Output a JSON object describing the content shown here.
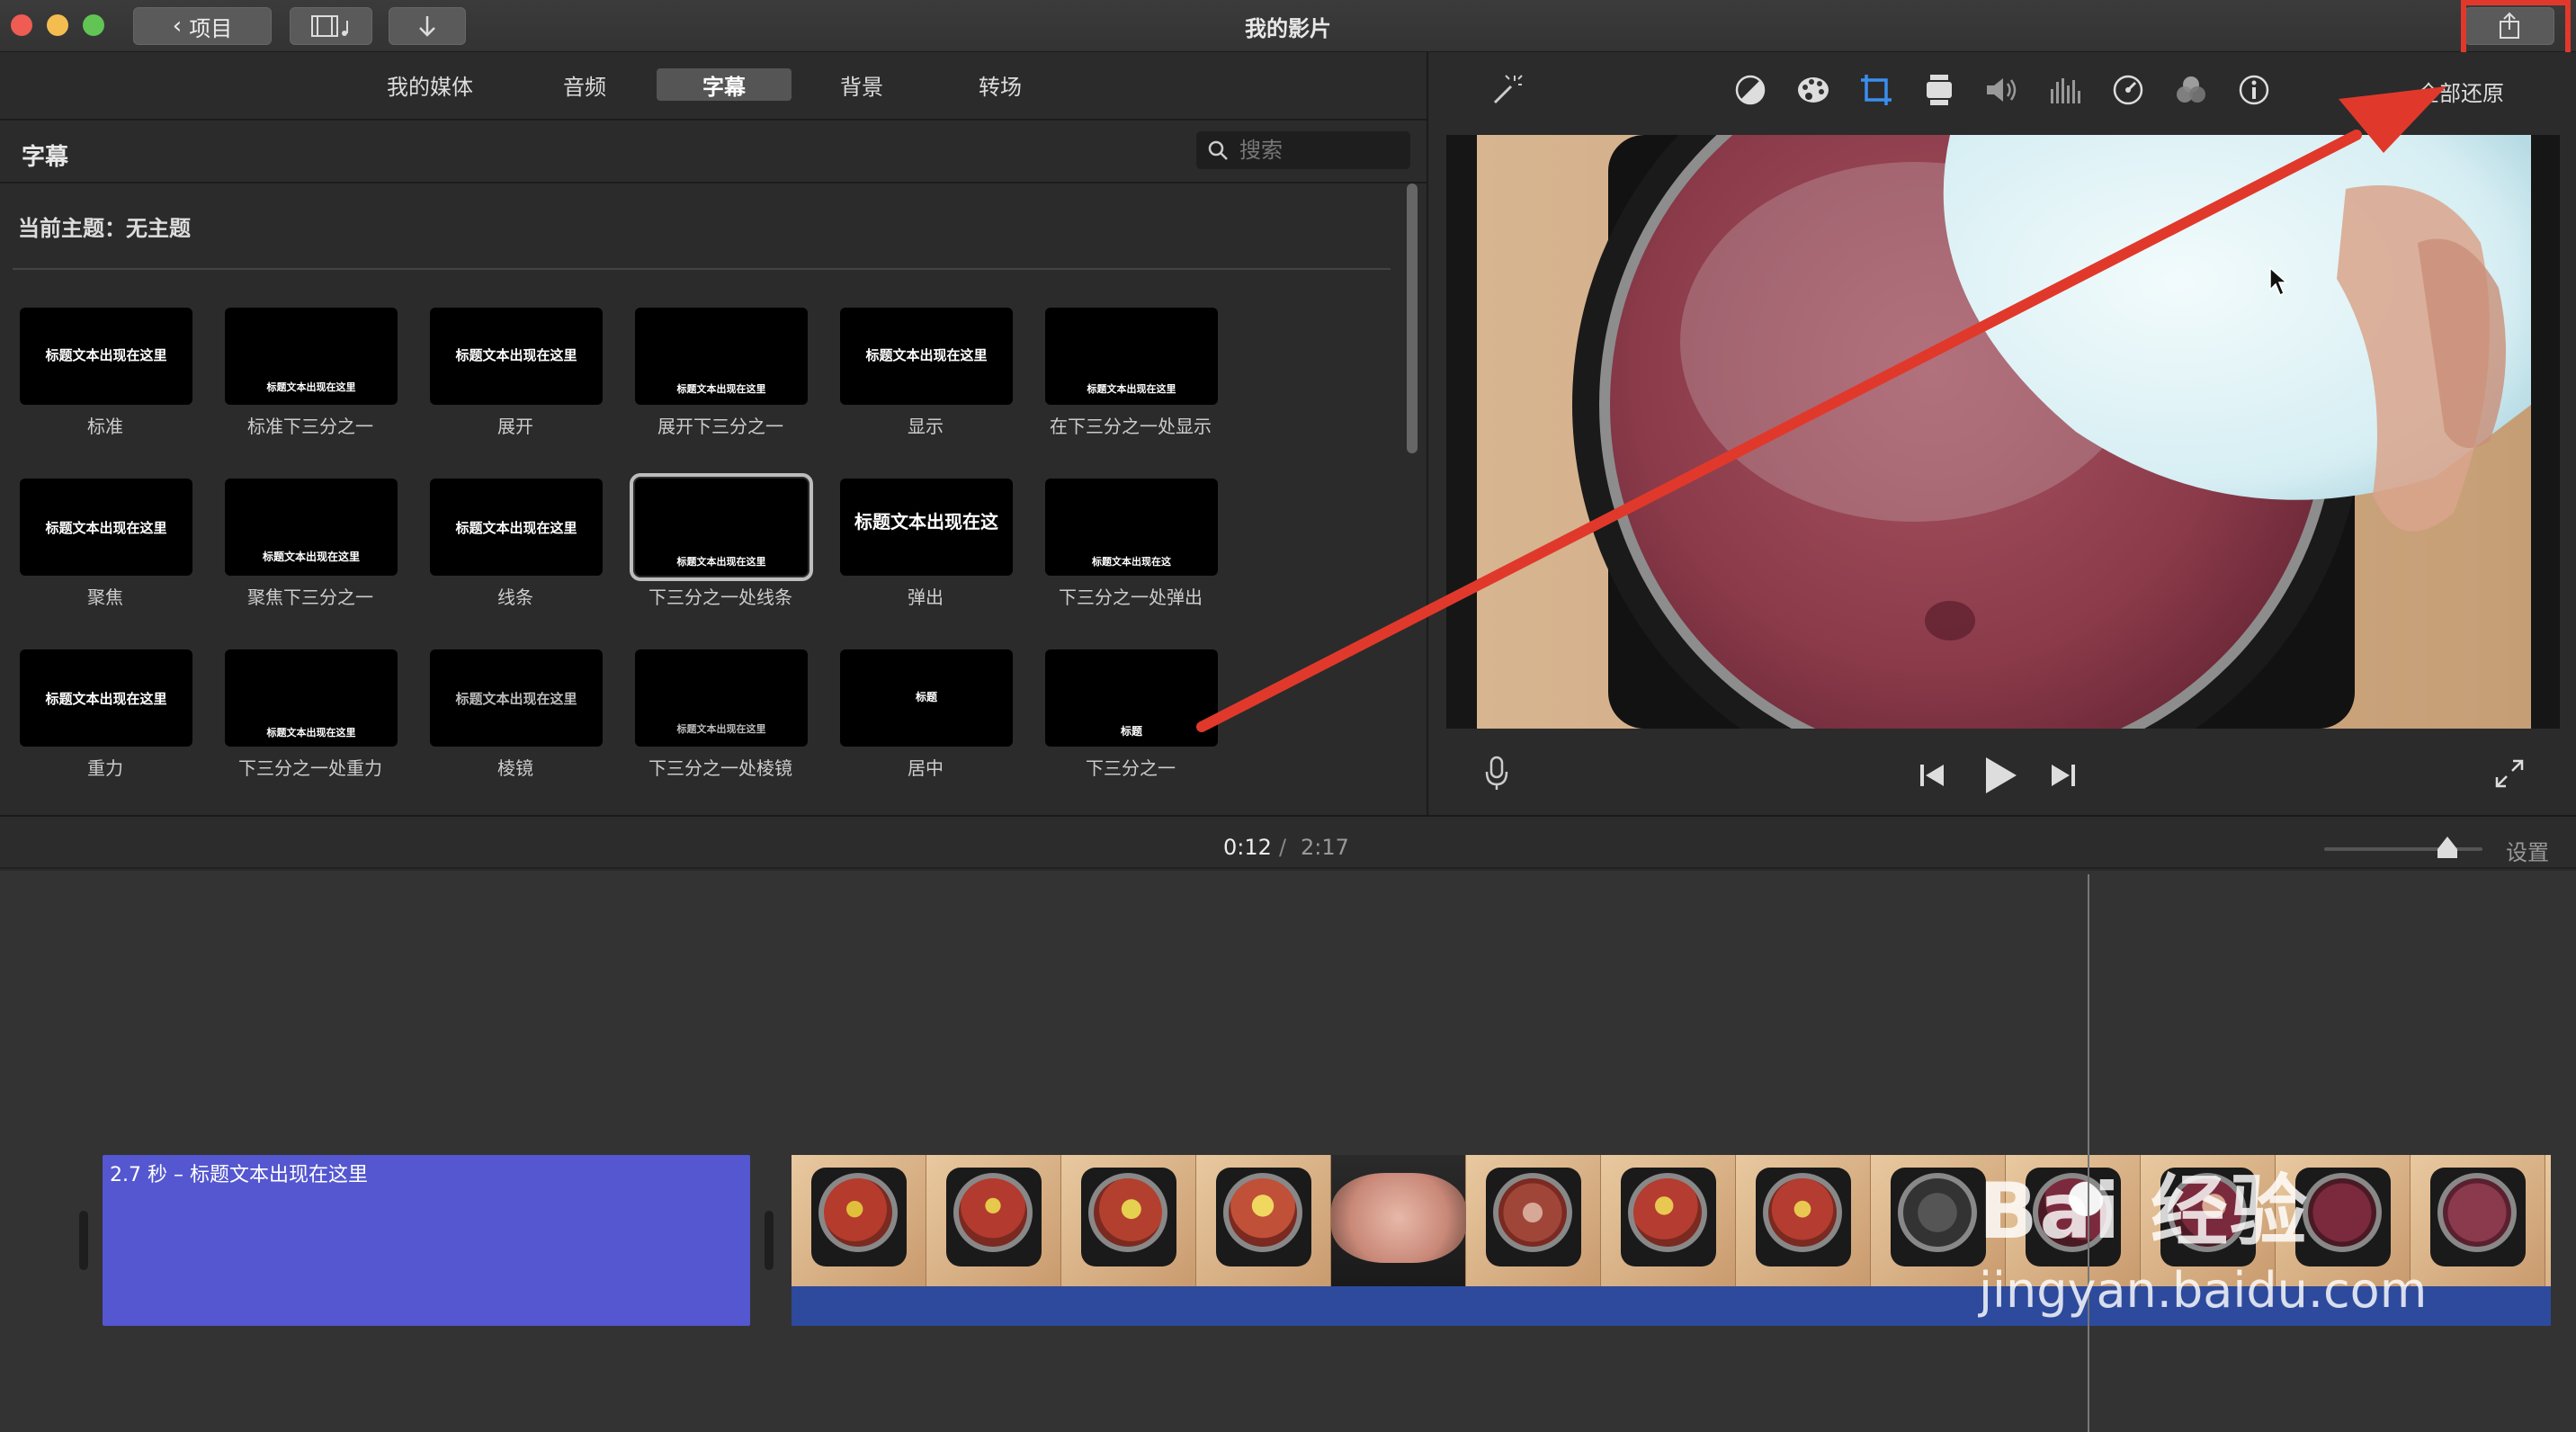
{
  "window": {
    "back_label": "项目",
    "title": "我的影片"
  },
  "browser": {
    "tabs": [
      {
        "label": "我的媒体",
        "active": false
      },
      {
        "label": "音频",
        "active": false
      },
      {
        "label": "字幕",
        "active": true
      },
      {
        "label": "背景",
        "active": false
      },
      {
        "label": "转场",
        "active": false
      }
    ],
    "section_title": "字幕",
    "search_placeholder": "搜索",
    "theme_label": "当前主题：无主题",
    "titles": [
      {
        "label": "标准",
        "preview": "标题文本出现在这里",
        "selected": false
      },
      {
        "label": "标准下三分之一",
        "preview": "标题文本出现在这里",
        "selected": false
      },
      {
        "label": "展开",
        "preview": "标题文本出现在这里",
        "selected": false
      },
      {
        "label": "展开下三分之一",
        "preview": "标题文本出现在这里",
        "selected": false
      },
      {
        "label": "显示",
        "preview": "标题文本出现在这里",
        "selected": false
      },
      {
        "label": "在下三分之一处显示",
        "preview": "标题文本出现在这里",
        "selected": false
      },
      {
        "label": "聚焦",
        "preview": "标题文本出现在这里",
        "selected": false
      },
      {
        "label": "聚焦下三分之一",
        "preview": "标题文本出现在这里",
        "selected": false
      },
      {
        "label": "线条",
        "preview": "标题文本出现在这里",
        "selected": false
      },
      {
        "label": "下三分之一处线条",
        "preview": "标题文本出现在这里",
        "selected": true
      },
      {
        "label": "弹出",
        "preview": "标题文本出现在这",
        "selected": false
      },
      {
        "label": "下三分之一处弹出",
        "preview": "标题文本出现在这",
        "selected": false
      },
      {
        "label": "重力",
        "preview": "标题文本出现在这里",
        "selected": false
      },
      {
        "label": "下三分之一处重力",
        "preview": "标题文本出现在这里",
        "selected": false
      },
      {
        "label": "棱镜",
        "preview": "标题文本出现在这里",
        "selected": false
      },
      {
        "label": "下三分之一处棱镜",
        "preview": "标题文本出现在这里",
        "selected": false
      },
      {
        "label": "居中",
        "preview": "标题",
        "selected": false
      },
      {
        "label": "下三分之一",
        "preview": "标题",
        "selected": false
      }
    ]
  },
  "viewer": {
    "reset_label": "全部还原",
    "tools": [
      "magic-wand-icon",
      "color-balance-icon",
      "color-palette-icon",
      "crop-icon",
      "stabilization-icon",
      "volume-icon",
      "equalizer-icon",
      "speed-icon",
      "filter-icon",
      "info-icon"
    ]
  },
  "timeline": {
    "current_time": "0:12",
    "separator": "/",
    "total_time": "2:17",
    "settings_label": "设置",
    "zoom_level": 0.78,
    "title_clip_label": "2.7 秒 – 标题文本出现在这里"
  },
  "watermark": {
    "main": "Bai 经验",
    "sub": "jingyan.baidu.com"
  },
  "colors": {
    "title_clip": "#5457cf",
    "video_clip": "#2d4a9d",
    "annotation": "#e0392b"
  }
}
